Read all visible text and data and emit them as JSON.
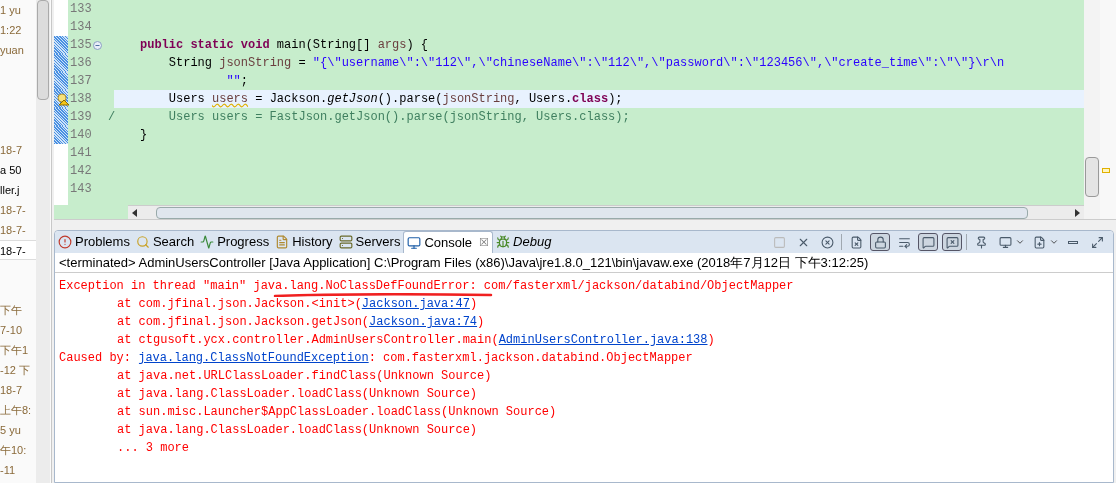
{
  "left_panel": {
    "groups": [
      {
        "rows": [
          {
            "text": "1 yu",
            "kind": "date",
            "selected": false
          },
          {
            "text": "1:22",
            "kind": "date",
            "selected": false
          },
          {
            "text": "yuan",
            "kind": "date",
            "selected": false
          }
        ]
      },
      {
        "rows": [
          {
            "text": "18-7",
            "kind": "date",
            "selected": false
          },
          {
            "text": "a 50",
            "kind": "file",
            "selected": false
          },
          {
            "text": "ller.j",
            "kind": "file",
            "selected": false
          },
          {
            "text": "18-7-",
            "kind": "date",
            "selected": false
          },
          {
            "text": "18-7-",
            "kind": "date",
            "selected": false
          },
          {
            "text": "18-7-",
            "kind": "file",
            "selected": true
          }
        ]
      },
      {
        "rows": [
          {
            "text": "下午",
            "kind": "date",
            "selected": false
          },
          {
            "text": "7-10",
            "kind": "date",
            "selected": false
          },
          {
            "text": "下午1",
            "kind": "date",
            "selected": false
          },
          {
            "text": "-12 下",
            "kind": "date",
            "selected": false
          },
          {
            "text": "18-7",
            "kind": "date",
            "selected": false
          },
          {
            "text": "上午8:",
            "kind": "date",
            "selected": false
          },
          {
            "text": "5 yu",
            "kind": "date",
            "selected": false
          },
          {
            "text": "午10:",
            "kind": "date",
            "selected": false
          },
          {
            "text": "-11",
            "kind": "date",
            "selected": false
          }
        ]
      }
    ]
  },
  "editor": {
    "lines": [
      {
        "number": "133",
        "changed": false,
        "foldable": false,
        "warning": false,
        "current": false
      },
      {
        "number": "134",
        "changed": false,
        "foldable": false,
        "warning": false,
        "current": false
      },
      {
        "number": "135",
        "changed": true,
        "foldable": true,
        "warning": false,
        "current": false,
        "tokens": [
          {
            "kind": "keyword",
            "text": "public static void"
          },
          {
            "kind": "plain",
            "text": " main(String[] "
          },
          {
            "kind": "variable",
            "text": "args"
          },
          {
            "kind": "plain",
            "text": ") {"
          }
        ]
      },
      {
        "number": "136",
        "changed": true,
        "foldable": false,
        "warning": false,
        "current": false,
        "tokens": [
          {
            "kind": "plain",
            "text": "    String "
          },
          {
            "kind": "variable",
            "text": "jsonString"
          },
          {
            "kind": "plain",
            "text": " = "
          },
          {
            "kind": "string",
            "text": "\"{\\\"username\\\":\\\"112\\\",\\\"chineseName\\\":\\\"112\\\",\\\"password\\\":\\\"123456\\\",\\\"create_time\\\":\\\"\\\"}\\r\\n"
          }
        ]
      },
      {
        "number": "137",
        "changed": true,
        "foldable": false,
        "warning": false,
        "current": false,
        "tokens": [
          {
            "kind": "string",
            "text": "            \"\""
          },
          {
            "kind": "plain",
            "text": ";"
          }
        ]
      },
      {
        "number": "138",
        "changed": true,
        "foldable": false,
        "warning": true,
        "current": true,
        "tokens": [
          {
            "kind": "plain",
            "text": "    Users "
          },
          {
            "kind": "warned",
            "text": "users"
          },
          {
            "kind": "plain",
            "text": " = Jackson."
          },
          {
            "kind": "static",
            "text": "getJson"
          },
          {
            "kind": "plain",
            "text": "().parse("
          },
          {
            "kind": "variable",
            "text": "jsonString"
          },
          {
            "kind": "plain",
            "text": ", Users."
          },
          {
            "kind": "keyword",
            "text": "class"
          },
          {
            "kind": "plain",
            "text": ");"
          }
        ]
      },
      {
        "number": "139",
        "changed": true,
        "foldable": false,
        "warning": false,
        "current": false,
        "margin": "/",
        "tokens": [
          {
            "kind": "comment",
            "text": "    Users users = FastJson.getJson().parse(jsonString, Users.class);"
          }
        ]
      },
      {
        "number": "140",
        "changed": true,
        "foldable": false,
        "warning": false,
        "current": false,
        "tokens": [
          {
            "kind": "plain",
            "text": "}"
          }
        ]
      },
      {
        "number": "141",
        "changed": false,
        "foldable": false,
        "warning": false,
        "current": false
      },
      {
        "number": "142",
        "changed": false,
        "foldable": false,
        "warning": false,
        "current": false
      },
      {
        "number": "143",
        "changed": false,
        "foldable": false,
        "warning": false,
        "current": false
      }
    ]
  },
  "console_view": {
    "tabs": [
      {
        "label": "Problems",
        "selected": false,
        "italic": false
      },
      {
        "label": "Search",
        "selected": false,
        "italic": false
      },
      {
        "label": "Progress",
        "selected": false,
        "italic": false
      },
      {
        "label": "History",
        "selected": false,
        "italic": false
      },
      {
        "label": "Servers",
        "selected": false,
        "italic": false
      },
      {
        "label": "Console",
        "selected": true,
        "italic": false,
        "close": "☒"
      },
      {
        "label": "Debug",
        "selected": false,
        "italic": true
      }
    ],
    "toolbar": [
      {
        "kind": "terminate",
        "on": false,
        "disabled": true
      },
      {
        "kind": "remove",
        "on": false,
        "disabled": false
      },
      {
        "kind": "remove-all",
        "on": false,
        "disabled": false
      },
      {
        "kind": "separator"
      },
      {
        "kind": "clear",
        "on": false,
        "disabled": false
      },
      {
        "kind": "scroll-lock",
        "on": true,
        "disabled": false
      },
      {
        "kind": "word-wrap",
        "on": false,
        "disabled": false
      },
      {
        "kind": "stdout",
        "on": true,
        "disabled": false
      },
      {
        "kind": "stderr",
        "on": true,
        "disabled": false
      },
      {
        "kind": "separator"
      },
      {
        "kind": "pin",
        "on": false,
        "disabled": false
      },
      {
        "kind": "display",
        "on": false,
        "disabled": false,
        "dropdown": true
      },
      {
        "kind": "new-console",
        "on": false,
        "disabled": false,
        "dropdown": true
      },
      {
        "kind": "minimize",
        "on": false,
        "disabled": false
      },
      {
        "kind": "maximize",
        "on": false,
        "disabled": false
      }
    ],
    "process": "<terminated> AdminUsersController [Java Application] C:\\Program Files (x86)\\Java\\jre1.8.0_121\\bin\\javaw.exe (2018年7月12日 下午3:12:25)",
    "output": [
      {
        "kind": "head",
        "segments": [
          {
            "text": "Exception in thread \"main\" java.lang.NoClassDefFoundError: com/fasterxml/jackson/databind/ObjectMapper"
          }
        ]
      },
      {
        "kind": "frame",
        "segments": [
          {
            "text": "at com.jfinal.json.Jackson.<init>("
          },
          {
            "text": "Jackson.java:47",
            "link": true
          },
          {
            "text": ")"
          }
        ]
      },
      {
        "kind": "frame",
        "segments": [
          {
            "text": "at com.jfinal.json.Jackson.getJson("
          },
          {
            "text": "Jackson.java:74",
            "link": true
          },
          {
            "text": ")"
          }
        ]
      },
      {
        "kind": "frame",
        "segments": [
          {
            "text": "at ctgusoft.ycx.controller.AdminUsersController.main("
          },
          {
            "text": "AdminUsersController.java:138",
            "link": true
          },
          {
            "text": ")"
          }
        ]
      },
      {
        "kind": "head",
        "segments": [
          {
            "text": "Caused by: "
          },
          {
            "text": "java.lang.ClassNotFoundException",
            "link": true
          },
          {
            "text": ": com.fasterxml.jackson.databind.ObjectMapper"
          }
        ]
      },
      {
        "kind": "frame",
        "segments": [
          {
            "text": "at java.net.URLClassLoader.findClass(Unknown Source)"
          }
        ]
      },
      {
        "kind": "frame",
        "segments": [
          {
            "text": "at java.lang.ClassLoader.loadClass(Unknown Source)"
          }
        ]
      },
      {
        "kind": "frame",
        "segments": [
          {
            "text": "at sun.misc.Launcher$AppClassLoader.loadClass(Unknown Source)"
          }
        ]
      },
      {
        "kind": "frame",
        "segments": [
          {
            "text": "at java.lang.ClassLoader.loadClass(Unknown Source)"
          }
        ]
      },
      {
        "kind": "frame",
        "segments": [
          {
            "text": "... 3 more"
          }
        ]
      }
    ]
  }
}
